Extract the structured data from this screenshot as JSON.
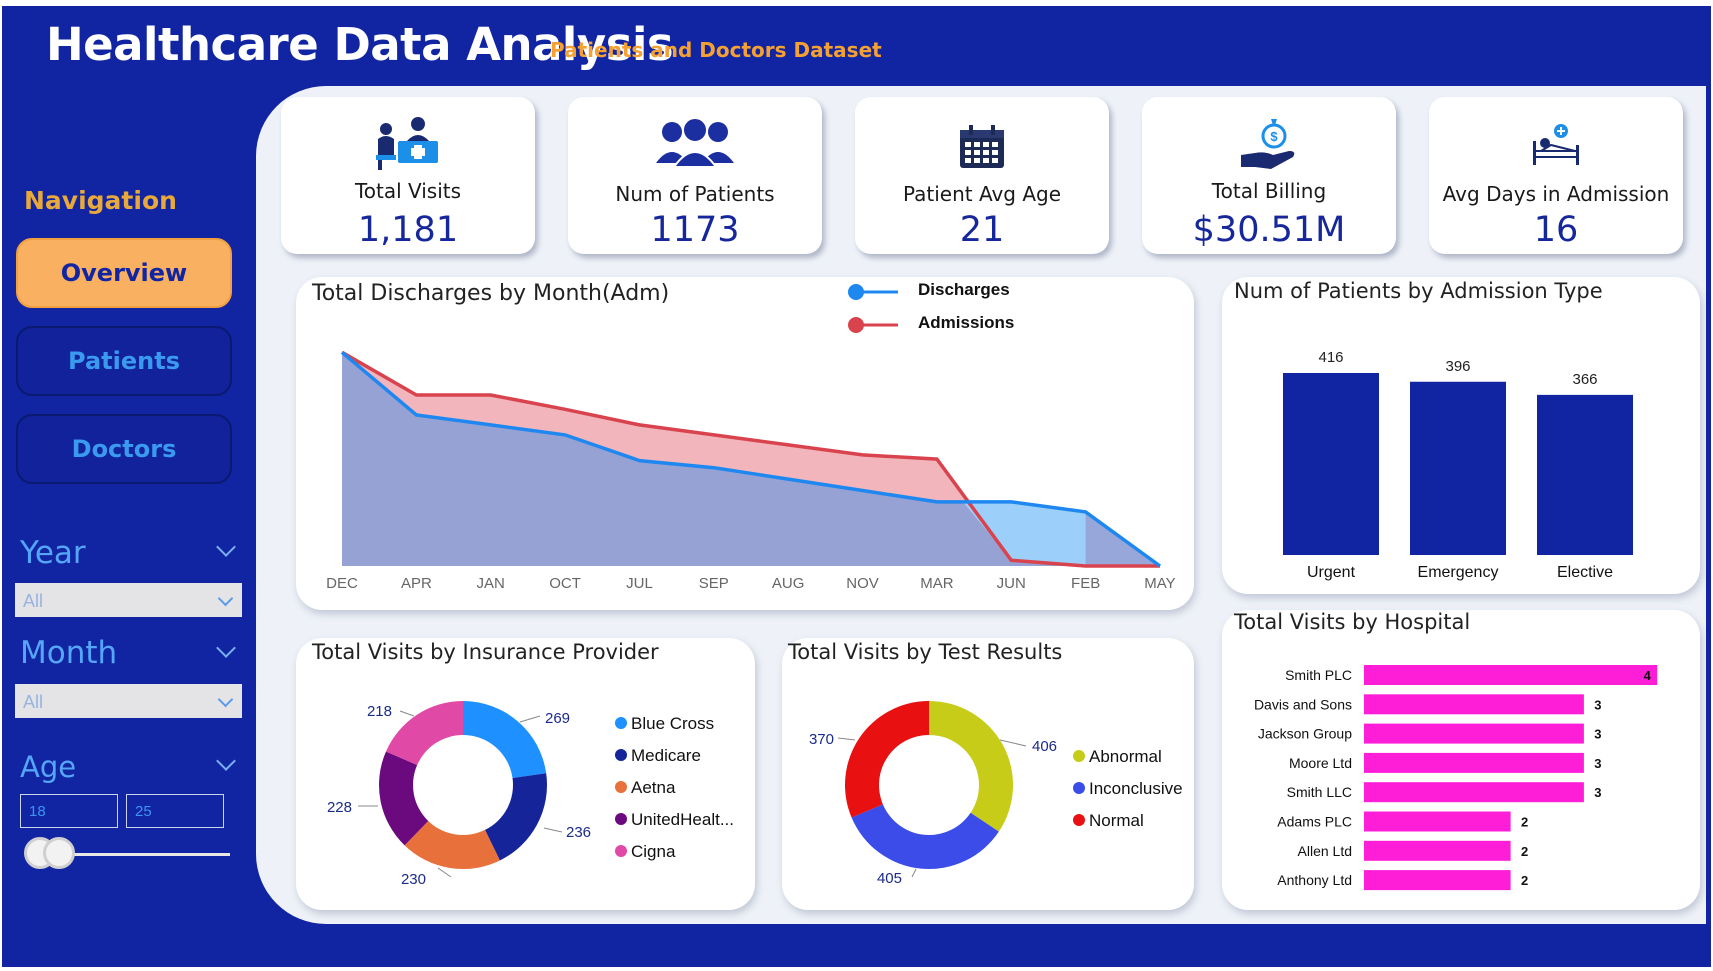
{
  "header": {
    "title": "Healthcare Data Analysis",
    "subtitle": "Patients and Doctors Dataset"
  },
  "navigation": {
    "heading": "Navigation",
    "items": [
      {
        "label": "Overview",
        "active": true
      },
      {
        "label": "Patients",
        "active": false
      },
      {
        "label": "Doctors",
        "active": false
      }
    ]
  },
  "filters": {
    "year": {
      "label": "Year",
      "value": "All"
    },
    "month": {
      "label": "Month",
      "value": "All"
    },
    "age": {
      "label": "Age",
      "min": "18",
      "max": "25"
    }
  },
  "kpis": [
    {
      "label": "Total Visits",
      "value": "1,181",
      "icon": "doctor-desk-icon"
    },
    {
      "label": "Num of Patients",
      "value": "1173",
      "icon": "people-group-icon"
    },
    {
      "label": "Patient Avg Age",
      "value": "21",
      "icon": "calendar-icon"
    },
    {
      "label": "Total Billing",
      "value": "$30.51M",
      "icon": "money-bag-hand-icon"
    },
    {
      "label": "Avg Days in Admission",
      "value": "16",
      "icon": "hospital-bed-icon"
    }
  ],
  "colors": {
    "background": "#1125a3",
    "discharges": "#1e88f0",
    "admissions": "#d9434d",
    "admission_bars": "#1125a3",
    "hospital_bars": "#ff1ed8"
  },
  "chart_data": [
    {
      "type": "area",
      "title": "Total Discharges by Month(Adm)",
      "categories": [
        "DEC",
        "APR",
        "JAN",
        "OCT",
        "JUL",
        "SEP",
        "AUG",
        "NOV",
        "MAR",
        "JUN",
        "FEB",
        "MAY"
      ],
      "series": [
        {
          "name": "Discharges",
          "values": [
            150,
            106,
            99,
            92,
            74,
            69,
            61,
            53,
            45,
            45,
            38,
            0
          ]
        },
        {
          "name": "Admissions",
          "values": [
            150,
            120,
            120,
            110,
            99,
            92,
            85,
            78,
            75,
            4,
            0,
            0
          ]
        }
      ],
      "ylim": [
        0,
        160
      ],
      "legend": "top-center"
    },
    {
      "type": "bar",
      "title": "Num of Patients by Admission Type",
      "categories": [
        "Urgent",
        "Emergency",
        "Elective"
      ],
      "values": [
        416,
        396,
        366
      ],
      "ylim": [
        0,
        450
      ]
    },
    {
      "type": "pie",
      "title": "Total Visits by Insurance Provider",
      "donut": true,
      "labels": [
        "Blue Cross",
        "Medicare",
        "Aetna",
        "UnitedHealt...",
        "Cigna"
      ],
      "values": [
        269,
        236,
        230,
        228,
        218
      ],
      "colors": [
        "#1e90ff",
        "#16249a",
        "#e8703a",
        "#6b0a7e",
        "#e04aa6"
      ],
      "legend": "right"
    },
    {
      "type": "pie",
      "title": "Total Visits by Test Results",
      "donut": true,
      "labels": [
        "Abnormal",
        "Inconclusive",
        "Normal"
      ],
      "values": [
        406,
        405,
        370
      ],
      "colors": [
        "#c7cc18",
        "#3b4ce8",
        "#e81010"
      ],
      "legend": "right"
    },
    {
      "type": "bar",
      "orientation": "horizontal",
      "title": "Total Visits by Hospital",
      "categories": [
        "Smith PLC",
        "Davis and Sons",
        "Jackson Group",
        "Moore Ltd",
        "Smith LLC",
        "Adams PLC",
        "Allen Ltd",
        "Anthony Ltd"
      ],
      "values": [
        4,
        3,
        3,
        3,
        3,
        2,
        2,
        2
      ]
    }
  ]
}
